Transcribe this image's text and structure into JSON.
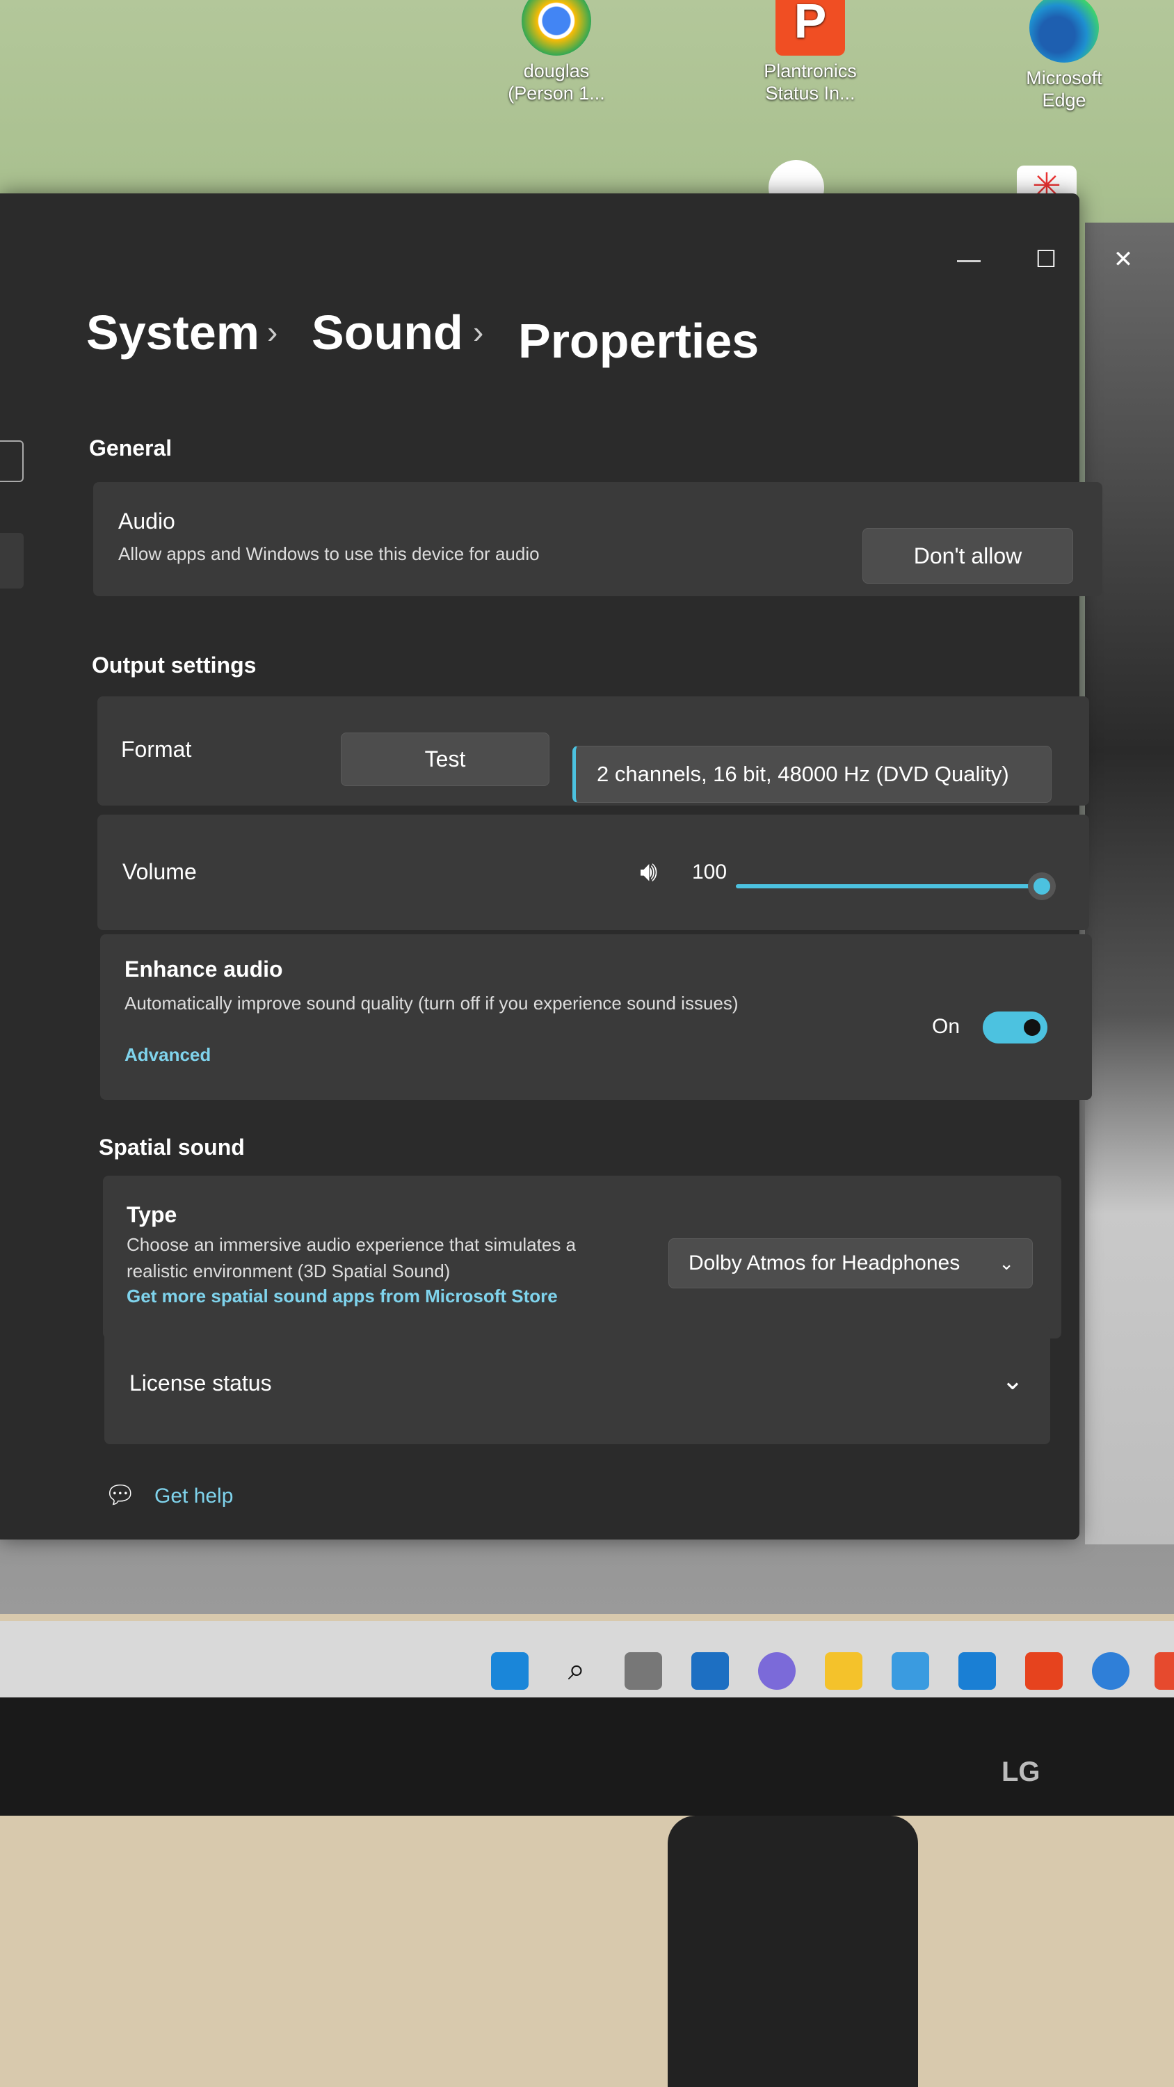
{
  "desktop": {
    "icons": [
      {
        "label": "douglas (Person 1...",
        "icon": "chrome-icon",
        "color": "#4285f4"
      },
      {
        "label": "Plantronics Status In...",
        "icon": "plantronics-icon",
        "color": "#f04e23"
      },
      {
        "label": "Microsoft Edge",
        "icon": "edge-icon",
        "color": "#1e90d0"
      }
    ]
  },
  "window": {
    "controls": {
      "minimize": "—",
      "maximize": "☐",
      "close": "✕"
    },
    "breadcrumb": [
      "System",
      "Sound",
      "Properties"
    ],
    "breadcrumb_sep": "›",
    "general": {
      "header": "General",
      "audio_title": "Audio",
      "audio_desc": "Allow apps and Windows to use this device for audio",
      "audio_button": "Don't allow"
    },
    "output": {
      "header": "Output settings",
      "format_label": "Format",
      "test_button": "Test",
      "format_value": "2 channels, 16 bit, 48000 Hz (DVD Quality)",
      "volume_label": "Volume",
      "volume_value": "100",
      "volume_percent": 100,
      "enhance_title": "Enhance audio",
      "enhance_desc": "Automatically improve sound quality (turn off if you experience sound issues)",
      "enhance_link": "Advanced",
      "enhance_state": "On",
      "enhance_on": true
    },
    "spatial": {
      "header": "Spatial sound",
      "type_title": "Type",
      "type_desc": "Choose an immersive audio experience that simulates a realistic environment (3D Spatial Sound)",
      "type_link": "Get more spatial sound apps from Microsoft Store",
      "type_value": "Dolby Atmos for Headphones",
      "license_label": "License status"
    },
    "help": "Get help",
    "accent": "#4cc2e0"
  },
  "monitor": {
    "brand": "LG"
  }
}
